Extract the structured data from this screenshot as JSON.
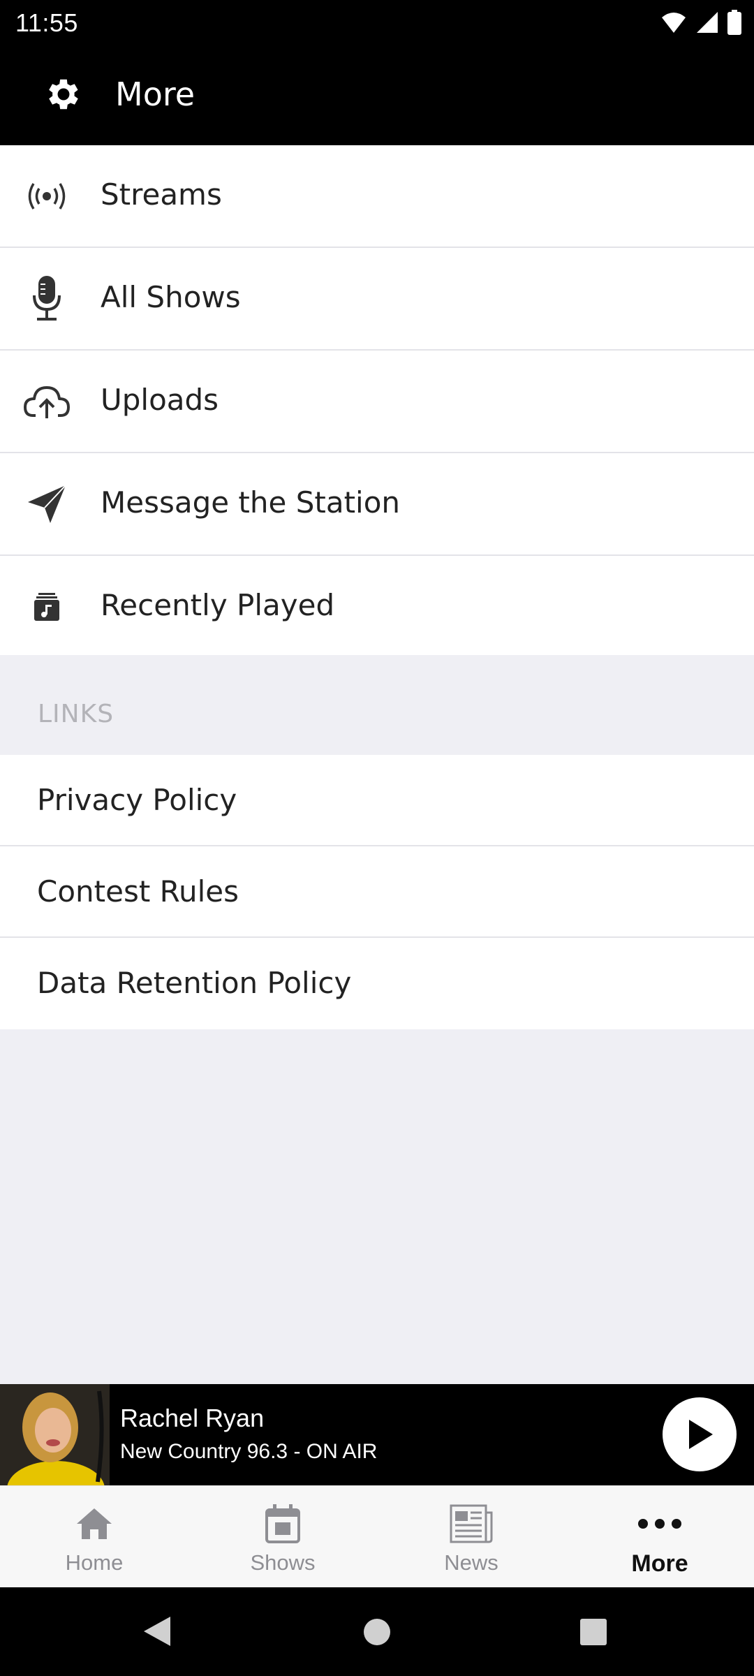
{
  "status_bar": {
    "time": "11:55"
  },
  "app_bar": {
    "title": "More",
    "icon": "gear-icon"
  },
  "menu": {
    "items": [
      {
        "label": "Streams",
        "icon": "broadcast-icon"
      },
      {
        "label": "All Shows",
        "icon": "microphone-icon"
      },
      {
        "label": "Uploads",
        "icon": "cloud-upload-icon"
      },
      {
        "label": "Message the Station",
        "icon": "paper-plane-icon"
      },
      {
        "label": "Recently Played",
        "icon": "music-note-icon"
      }
    ]
  },
  "links_section": {
    "header": "LINKS",
    "items": [
      {
        "label": "Privacy Policy"
      },
      {
        "label": "Contest Rules"
      },
      {
        "label": "Data Retention Policy"
      }
    ]
  },
  "player": {
    "host_name": "Rachel Ryan",
    "station": "New Country 96.3 - ON AIR",
    "play_icon": "play-icon"
  },
  "tabs": [
    {
      "label": "Home",
      "icon": "home-icon",
      "active": false
    },
    {
      "label": "Shows",
      "icon": "calendar-icon",
      "active": false
    },
    {
      "label": "News",
      "icon": "newspaper-icon",
      "active": false
    },
    {
      "label": "More",
      "icon": "more-dots-icon",
      "active": true
    }
  ],
  "colors": {
    "bar_bg": "#000000",
    "page_bg": "#efeff4",
    "inactive_tab": "#8e8e93"
  }
}
